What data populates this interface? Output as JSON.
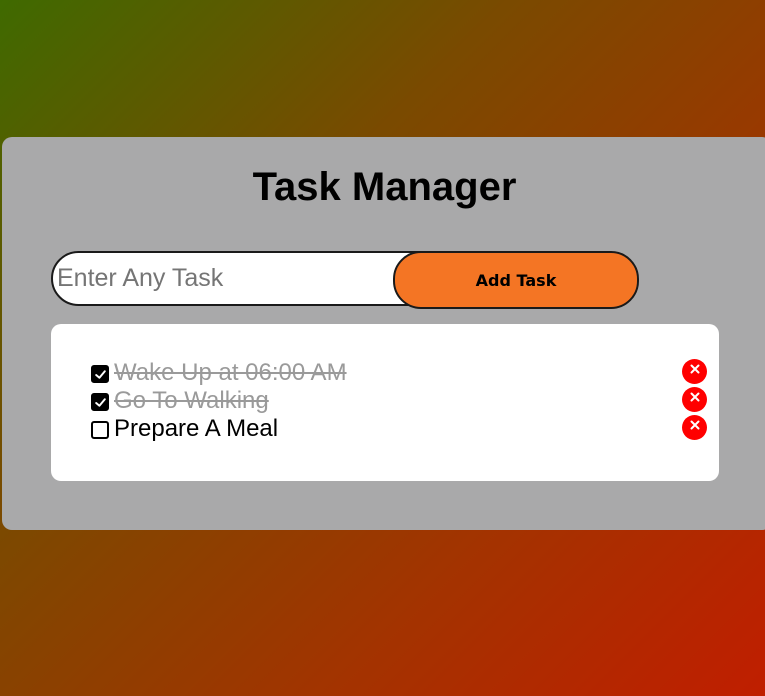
{
  "app": {
    "title": "Task Manager"
  },
  "input": {
    "placeholder": "Enter Any Task",
    "value": ""
  },
  "add_button": {
    "label": "Add Task"
  },
  "tasks": [
    {
      "text": "Wake Up at 06:00 AM",
      "completed": true
    },
    {
      "text": "Go To Walking",
      "completed": true
    },
    {
      "text": "Prepare A Meal",
      "completed": false
    }
  ],
  "colors": {
    "card": "#a9a9aa",
    "accent": "#f47524",
    "delete": "#ff0000",
    "completed_text": "#9a9a9a"
  },
  "icons": {
    "checkbox": "check-icon",
    "delete": "close-icon"
  }
}
